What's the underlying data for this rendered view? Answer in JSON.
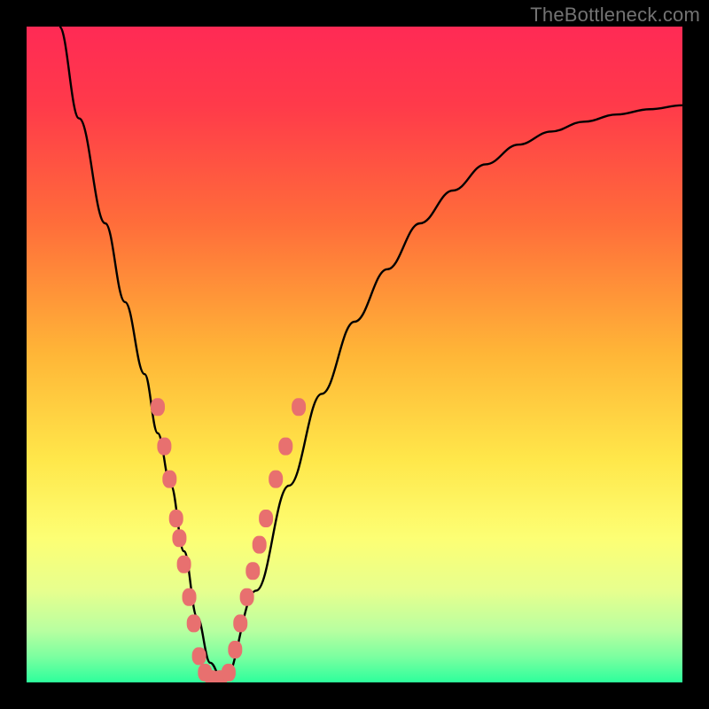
{
  "watermark": "TheBottleneck.com",
  "chart_data": {
    "type": "line",
    "title": "",
    "xlabel": "",
    "ylabel": "",
    "xlim": [
      0,
      100
    ],
    "ylim": [
      0,
      100
    ],
    "background_gradient_stops": [
      {
        "pos": 0.0,
        "color": "#ff2a55"
      },
      {
        "pos": 0.12,
        "color": "#ff3a4a"
      },
      {
        "pos": 0.3,
        "color": "#ff6d3a"
      },
      {
        "pos": 0.5,
        "color": "#ffb637"
      },
      {
        "pos": 0.66,
        "color": "#ffe74a"
      },
      {
        "pos": 0.78,
        "color": "#fdff74"
      },
      {
        "pos": 0.86,
        "color": "#e7ff8e"
      },
      {
        "pos": 0.92,
        "color": "#b9ffa0"
      },
      {
        "pos": 0.96,
        "color": "#7dffa0"
      },
      {
        "pos": 1.0,
        "color": "#2dff9c"
      }
    ],
    "series": [
      {
        "name": "bottleneck-curve",
        "color": "#000000",
        "x": [
          5,
          8,
          12,
          15,
          18,
          20,
          22,
          24,
          26,
          28,
          30,
          35,
          40,
          45,
          50,
          55,
          60,
          65,
          70,
          75,
          80,
          85,
          90,
          95,
          100
        ],
        "y": [
          100,
          86,
          70,
          58,
          47,
          38,
          30,
          20,
          10,
          3,
          0,
          14,
          30,
          44,
          55,
          63,
          70,
          75,
          79,
          82,
          84,
          85.5,
          86.6,
          87.4,
          88
        ]
      }
    ],
    "markers": {
      "name": "data-points",
      "shape": "rounded-rect",
      "color": "#e8706f",
      "points": [
        {
          "x": 20.0,
          "y": 42
        },
        {
          "x": 21.0,
          "y": 36
        },
        {
          "x": 21.8,
          "y": 31
        },
        {
          "x": 22.8,
          "y": 25
        },
        {
          "x": 23.3,
          "y": 22
        },
        {
          "x": 24.0,
          "y": 18
        },
        {
          "x": 24.8,
          "y": 13
        },
        {
          "x": 25.5,
          "y": 9
        },
        {
          "x": 26.3,
          "y": 4
        },
        {
          "x": 27.2,
          "y": 1.5
        },
        {
          "x": 28.3,
          "y": 0.5
        },
        {
          "x": 29.5,
          "y": 0.5
        },
        {
          "x": 30.8,
          "y": 1.5
        },
        {
          "x": 31.8,
          "y": 5
        },
        {
          "x": 32.6,
          "y": 9
        },
        {
          "x": 33.6,
          "y": 13
        },
        {
          "x": 34.5,
          "y": 17
        },
        {
          "x": 35.5,
          "y": 21
        },
        {
          "x": 36.5,
          "y": 25
        },
        {
          "x": 38.0,
          "y": 31
        },
        {
          "x": 39.5,
          "y": 36
        },
        {
          "x": 41.5,
          "y": 42
        }
      ]
    }
  }
}
